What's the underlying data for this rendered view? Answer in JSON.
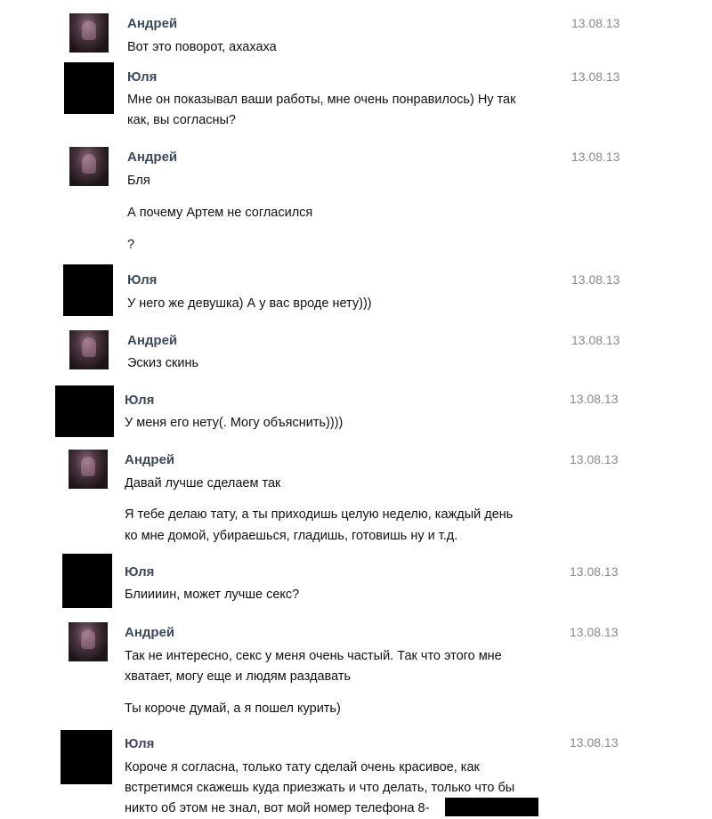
{
  "messages": [
    {
      "author": "Андрей",
      "date": "13.08.13",
      "lines": [
        "Вот это поворот, ахахаха"
      ]
    },
    {
      "author": "Юля",
      "date": "13.08.13",
      "lines": [
        "Мне он показывал ваши работы, мне очень понравилось) Ну так",
        "как, вы согласны?"
      ]
    },
    {
      "author": "Андрей",
      "date": "13.08.13",
      "lines": [
        "Бля",
        "А почему Артем не согласился",
        "?"
      ]
    },
    {
      "author": "Юля",
      "date": "13.08.13",
      "lines": [
        "У него же девушка) А у вас вроде нету)))"
      ]
    },
    {
      "author": "Андрей",
      "date": "13.08.13",
      "lines": [
        "Эскиз скинь"
      ]
    },
    {
      "author": "Юля",
      "date": "13.08.13",
      "lines": [
        "У меня его нету(. Могу объяснить))))"
      ]
    },
    {
      "author": "Андрей",
      "date": "13.08.13",
      "lines": [
        "Давай лучше сделаем так",
        "Я тебе делаю тату, а ты приходишь целую неделю, каждый день",
        "ко мне домой, убираешься, гладишь, готовишь ну и т.д."
      ]
    },
    {
      "author": "Юля",
      "date": "13.08.13",
      "lines": [
        "Блиииин, может лучше секс?"
      ]
    },
    {
      "author": "Андрей",
      "date": "13.08.13",
      "lines": [
        "Так не интересно, секс у меня очень частый. Так что этого мне",
        "хватает, могу еще и людям раздавать",
        "Ты короче думай, а я пошел курить)"
      ]
    },
    {
      "author": "Юля",
      "date": "13.08.13",
      "lines": [
        "Короче я согласна, только тату сделай очень красивое, как",
        "встретимся скажешь куда приезжать и что делать, только что бы",
        "никто об этом не знал, вот мой номер телефона 8-"
      ]
    }
  ]
}
